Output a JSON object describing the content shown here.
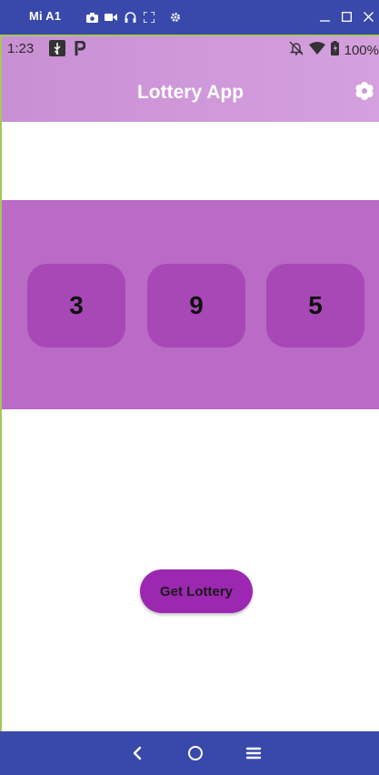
{
  "window": {
    "device_name": "Mi A1",
    "toolbar_icons": [
      "camera-icon",
      "video-icon",
      "headset-icon",
      "fullscreen-icon",
      "settings-icon"
    ],
    "controls": [
      "minimize-icon",
      "maximize-icon",
      "close-icon"
    ],
    "color": "#3949ab"
  },
  "status_bar": {
    "time": "1:23",
    "left_icons": [
      "usb-icon",
      "p-icon"
    ],
    "right_icons": [
      "mute-icon",
      "wifi-icon",
      "battery-icon"
    ],
    "battery": "100%"
  },
  "app_bar": {
    "title": "Lottery App",
    "menu_icon": "flower-icon"
  },
  "lottery": {
    "numbers": [
      "3",
      "9",
      "5"
    ],
    "band_color": "#b96bc5",
    "card_color": "#a748b6"
  },
  "actions": {
    "get_lottery_label": "Get Lottery",
    "button_color": "#9c27b0"
  },
  "nav_bar": {
    "buttons": [
      "back-icon",
      "home-icon",
      "recents-icon"
    ]
  }
}
